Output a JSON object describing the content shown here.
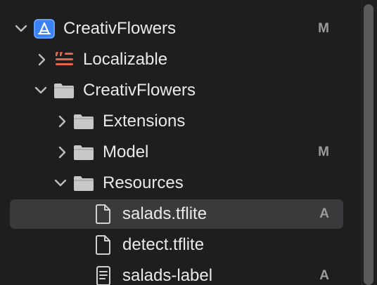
{
  "navigator": {
    "rows": [
      {
        "label": "CreativFlowers",
        "badge": "M",
        "icon": "xcode-project-icon",
        "expanded": true
      },
      {
        "label": "Localizable",
        "badge": "",
        "icon": "strings-file-icon",
        "expanded": false
      },
      {
        "label": "CreativFlowers",
        "badge": "",
        "icon": "folder-icon",
        "expanded": true
      },
      {
        "label": "Extensions",
        "badge": "",
        "icon": "folder-icon",
        "expanded": false
      },
      {
        "label": "Model",
        "badge": "M",
        "icon": "folder-icon",
        "expanded": false
      },
      {
        "label": "Resources",
        "badge": "",
        "icon": "folder-icon",
        "expanded": true
      },
      {
        "label": "salads.tflite",
        "badge": "A",
        "icon": "file-icon",
        "selected": true
      },
      {
        "label": "detect.tflite",
        "badge": "",
        "icon": "file-icon"
      },
      {
        "label": "salads-label",
        "badge": "A",
        "icon": "text-file-icon"
      }
    ]
  },
  "colors": {
    "background": "#1e1e1e",
    "selection": "#3a3a3c",
    "project_icon": "#3b82f6",
    "strings_icon": "#e8654a",
    "folder_icon": "#c8c8c8",
    "badge_text": "#9b9b9b"
  }
}
